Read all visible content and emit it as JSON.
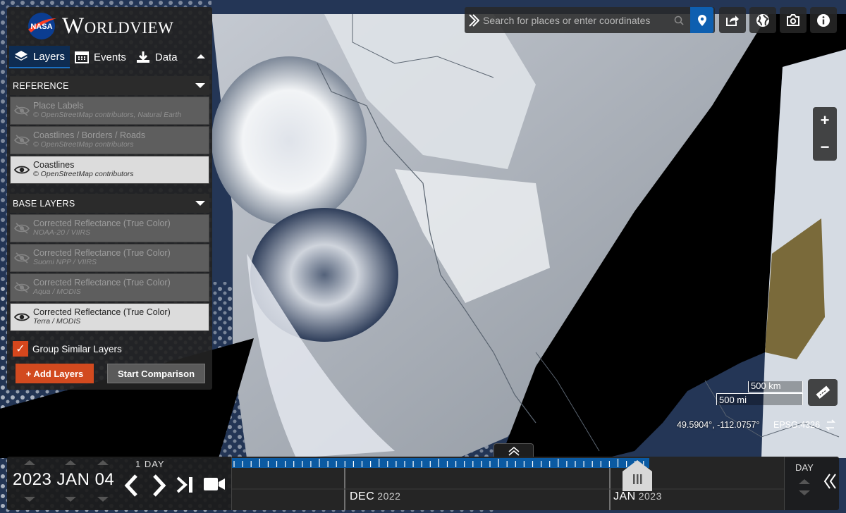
{
  "app": {
    "brand": "Worldview",
    "logo": "nasa-logo"
  },
  "tabs": [
    {
      "label": "Layers",
      "icon": "layers-icon",
      "active": true
    },
    {
      "label": "Events",
      "icon": "calendar-icon",
      "active": false
    },
    {
      "label": "Data",
      "icon": "download-icon",
      "active": false
    }
  ],
  "reference": {
    "header": "REFERENCE",
    "layers": [
      {
        "name": "Place Labels",
        "attribution": "© OpenStreetMap contributors, Natural Earth",
        "visible": false
      },
      {
        "name": "Coastlines / Borders / Roads",
        "attribution": "© OpenStreetMap contributors",
        "visible": false
      },
      {
        "name": "Coastlines",
        "attribution": "© OpenStreetMap contributors",
        "visible": true
      }
    ]
  },
  "base": {
    "header": "BASE LAYERS",
    "layers": [
      {
        "name": "Corrected Reflectance (True Color)",
        "attribution": "NOAA-20 / VIIRS",
        "visible": false
      },
      {
        "name": "Corrected Reflectance (True Color)",
        "attribution": "Suomi NPP / VIIRS",
        "visible": false
      },
      {
        "name": "Corrected Reflectance (True Color)",
        "attribution": "Aqua / MODIS",
        "visible": false
      },
      {
        "name": "Corrected Reflectance (True Color)",
        "attribution": "Terra / MODIS",
        "visible": true
      }
    ]
  },
  "group_similar": {
    "label": "Group Similar Layers",
    "checked": true
  },
  "buttons": {
    "add_layers": "+ Add Layers",
    "start_comparison": "Start Comparison"
  },
  "search": {
    "placeholder": "Search for places or enter coordinates"
  },
  "toolbar": [
    "share-icon",
    "projection-globe-icon",
    "camera-icon",
    "info-icon"
  ],
  "zoom": {
    "in": "+",
    "out": "−"
  },
  "scale": {
    "km": "500 km",
    "mi": "500 mi"
  },
  "coordinates": {
    "latlon": "49.5904°, -112.0757°",
    "projection": "EPSG:4326"
  },
  "timeline": {
    "date": "2023 JAN 04",
    "interval": "1 DAY",
    "months": [
      {
        "label": "DEC",
        "year": "2022"
      },
      {
        "label": "JAN",
        "year": "2023"
      }
    ],
    "zoom_level": "DAY"
  },
  "colors": {
    "accent": "#d24a1f",
    "selected_tab": "#0e2c52",
    "pin": "#0e5fb0",
    "timeline_ticks": "#0b5aa2"
  }
}
